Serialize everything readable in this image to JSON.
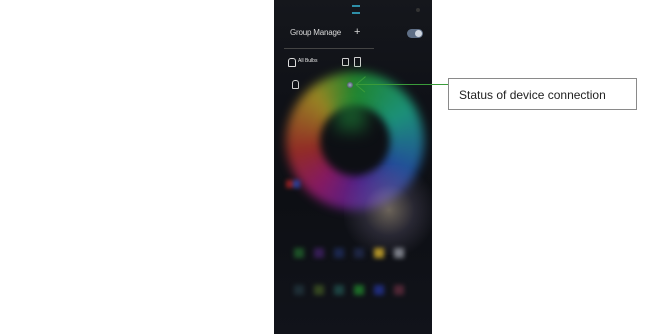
{
  "app": {
    "header": {
      "title": "Group Manage",
      "add_symbol": "+"
    },
    "device": {
      "name": "All Bulbs"
    }
  },
  "annotation": {
    "label": "Status of device connection"
  },
  "swatches": {
    "row1": [
      "#1f5c2a",
      "#3c1f5e",
      "#1d2a55",
      "#20294a",
      "#c9a62a",
      "#8c8f99"
    ],
    "row2": [
      "#20323a",
      "#3a4f22",
      "#1f4a47",
      "#1f7a2a",
      "#22308a",
      "#5a2a3a"
    ]
  }
}
